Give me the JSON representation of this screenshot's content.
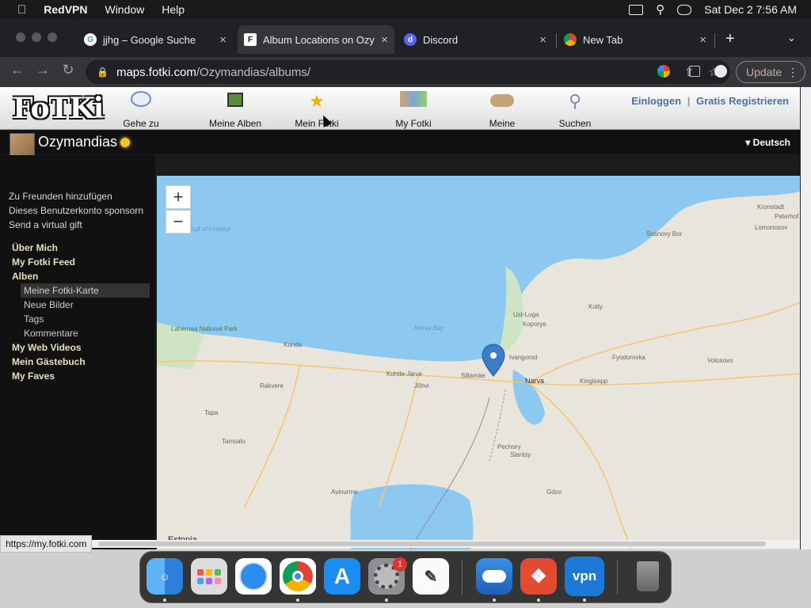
{
  "menubar": {
    "app": "RedVPN",
    "items": [
      "Window",
      "Help"
    ],
    "datetime": "Sat Dec 2  7:56 AM"
  },
  "tabs": [
    {
      "title": "jjhg – Google Suche"
    },
    {
      "title": "Album Locations on Ozy"
    },
    {
      "title": "Discord"
    },
    {
      "title": "New Tab"
    }
  ],
  "new_tab_symbol": "+",
  "address": {
    "host": "maps.fotki.com",
    "path": "/Ozymandias/albums/"
  },
  "update_label": "Update",
  "fotki": {
    "logo": "FoTKi",
    "nav": [
      "Gehe zu",
      "Meine Alben",
      "Mein Fotki",
      "My Fotki Feed",
      "Meine Freunde",
      "Suchen"
    ],
    "login": "Einloggen",
    "separator": "|",
    "register": "Gratis Registrieren",
    "username": "Ozymandias",
    "language": "▾ Deutsch"
  },
  "sidebar": {
    "links": [
      "Zu Freunden hinzufügen",
      "Dieses Benutzerkonto sponsorn",
      "Send a virtual gift"
    ],
    "sections": [
      {
        "label": "Über Mich"
      },
      {
        "label": "My Fotki Feed"
      },
      {
        "label": "Alben",
        "children": [
          "Meine Fotki-Karte",
          "Neue Bilder",
          "Tags",
          "Kommentare"
        ],
        "selected": "Meine Fotki-Karte"
      },
      {
        "label": "My Web Videos"
      },
      {
        "label": "Mein Gästebuch"
      },
      {
        "label": "My Faves"
      }
    ]
  },
  "map": {
    "zoom_in": "+",
    "zoom_out": "−",
    "country_label": "Estonia",
    "places": [
      "Gulf of Finland",
      "Narva Bay",
      "Kunda",
      "Kohtla-Järve",
      "Jõhvi",
      "Sillamäe",
      "Narva",
      "Kingisepp",
      "Tapa",
      "Rakvere",
      "Ivangorod",
      "Lomonosov",
      "Peterhof",
      "Kronstadt",
      "Sosnovy Bor",
      "Lahemaa National Park",
      "Tamsalu",
      "Avinurme",
      "Slantsy",
      "Gdov",
      "Pechory",
      "Volosovo",
      "Kotly",
      "Ust-Luga",
      "Fyodorovka",
      "Koporye"
    ],
    "marker_color": "#3d7cc9",
    "water_color": "#8cc8ef"
  },
  "status_url": "https://my.fotki.com",
  "dock": {
    "apps": [
      "finder-icon",
      "launchpad-icon",
      "safari-icon",
      "chrome-icon",
      "app-store-icon",
      "system-preferences-icon",
      "textedit-icon",
      "weather-icon",
      "anydesk-icon",
      "redvpn-icon",
      "trash-icon"
    ],
    "badge": "1",
    "vpn_label": "vpn"
  }
}
